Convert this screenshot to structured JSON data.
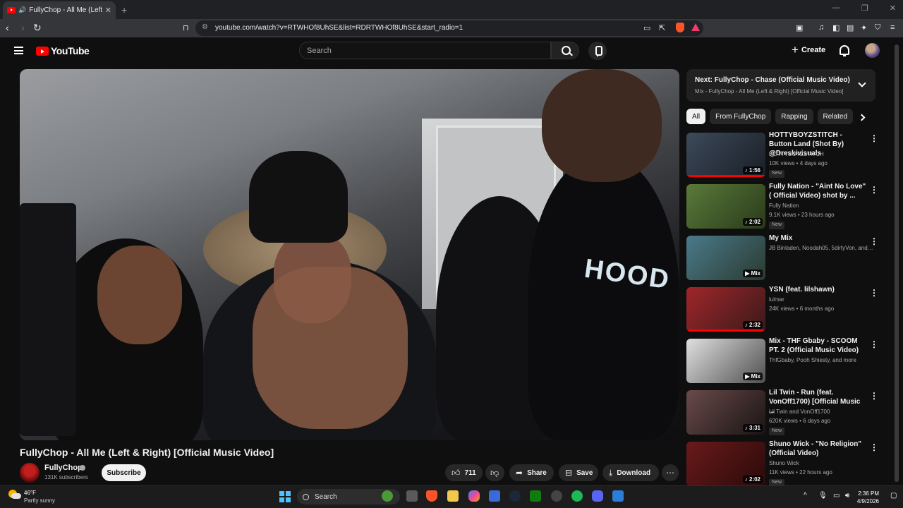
{
  "browser": {
    "tab_title": "FullyChop - All Me (Left & Ri",
    "url": "youtube.com/watch?v=RTWHOf8UhSE&list=RDRTWHOf8UhSE&start_radio=1"
  },
  "header": {
    "logo_text": "YouTube",
    "search_placeholder": "Search",
    "create_label": "Create"
  },
  "video": {
    "title": "FullyChop - All Me (Left & Right) [Official Music Video]",
    "overlay_text": "HOOD",
    "channel_name": "FullyChop",
    "subscribers": "131K subscribers",
    "subscribe_label": "Subscribe",
    "likes": "711",
    "share_label": "Share",
    "save_label": "Save",
    "download_label": "Download"
  },
  "up_next": {
    "title": "Next: FullyChop - Chase (Official Music Video)",
    "subtitle": "Mix - FullyChop - All Me (Left & Right) [Official Music Video]"
  },
  "chips": [
    "All",
    "From FullyChop",
    "Rapping",
    "Related"
  ],
  "recommendations": [
    {
      "title": "HOTTYBOYZSTITCH - Button Land (Shot By) @Dreskivisuals",
      "channel": "HOTTYBOYZSTITCH",
      "meta": "10K views • 4 days ago",
      "badge": "New",
      "duration": "♪ 1:56",
      "watched": true,
      "thumb_colors": [
        "#3c4a5a",
        "#1a1f26"
      ]
    },
    {
      "title": "Fully Nation - \"Aint No Love\" ( Official Video) shot by ...",
      "channel": "Fully Nation",
      "meta": "9.1K views • 23 hours ago",
      "badge": "New",
      "duration": "♪ 2:02",
      "watched": false,
      "thumb_colors": [
        "#5a7a3a",
        "#2a3a1a"
      ]
    },
    {
      "title": "My Mix",
      "channel": "JB Binladen, Noodah05, 5dirtyVon, and ...",
      "meta": "",
      "badge": "",
      "duration": "▶ Mix",
      "watched": false,
      "thumb_colors": [
        "#4a7a8a",
        "#2a3a30"
      ]
    },
    {
      "title": "YSN (feat. lilshawn)",
      "channel": "lulmar",
      "meta": "24K views • 6 months ago",
      "badge": "",
      "duration": "♪ 2:32",
      "watched": true,
      "thumb_colors": [
        "#a0262a",
        "#3a1a1a"
      ]
    },
    {
      "title": "Mix - THF Gbaby - SCOOM PT. 2 (Official Music Video)",
      "channel": "ThfGbaby, Pooh Shiesty, and more",
      "meta": "",
      "badge": "",
      "duration": "▶ Mix",
      "watched": false,
      "thumb_colors": [
        "#e0e0e0",
        "#505050"
      ]
    },
    {
      "title": "Lil Twin - Run (feat. VonOff1700) [Official Music ...",
      "channel": "Lil Twin and VonOff1700",
      "meta": "620K views • 6 days ago",
      "badge": "New",
      "duration": "♪ 3:31",
      "watched": false,
      "thumb_colors": [
        "#6a4a4a",
        "#1a1414"
      ]
    },
    {
      "title": "Shuno Wick - \"No Religion\" (Official Video)",
      "channel": "Shuno Wick",
      "meta": "11K views • 22 hours ago",
      "badge": "New",
      "duration": "♪ 2:02",
      "watched": false,
      "thumb_colors": [
        "#6a1a1a",
        "#2a0a0a"
      ]
    }
  ],
  "taskbar": {
    "temp": "46°F",
    "weather": "Partly sunny",
    "search_label": "Search",
    "time": "2:36 PM",
    "date": "4/9/2026"
  }
}
